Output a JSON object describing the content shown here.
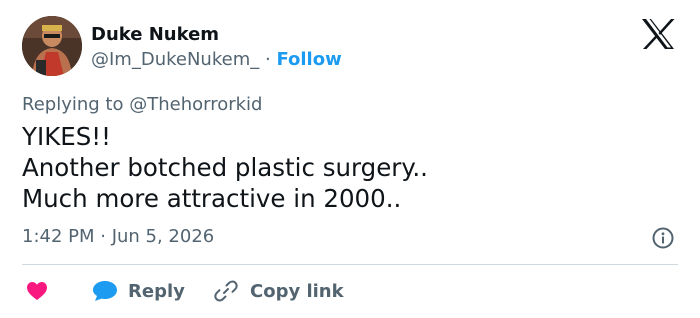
{
  "author": {
    "name": "Duke Nukem",
    "handle": "@Im_DukeNukem_",
    "separator": "·",
    "follow_label": "Follow"
  },
  "reply_context": {
    "prefix": "Replying to",
    "mention": "@Thehorrorkid"
  },
  "tweet": {
    "lines": [
      "YIKES!!",
      "Another botched plastic surgery..",
      "Much more attractive in 2000.."
    ],
    "timestamp": "1:42 PM · Jun 5, 2026"
  },
  "actions": {
    "reply_label": "Reply",
    "copy_label": "Copy link"
  },
  "icons": {
    "logo": "x-logo-icon",
    "info": "info-icon",
    "like": "heart-icon",
    "reply": "speech-bubble-icon",
    "copy": "link-icon"
  },
  "colors": {
    "follow": "#1d9bf0",
    "reply_bubble": "#1d9bf0",
    "heart": "#f91880",
    "muted_text": "#536471",
    "text": "#0f1419"
  }
}
